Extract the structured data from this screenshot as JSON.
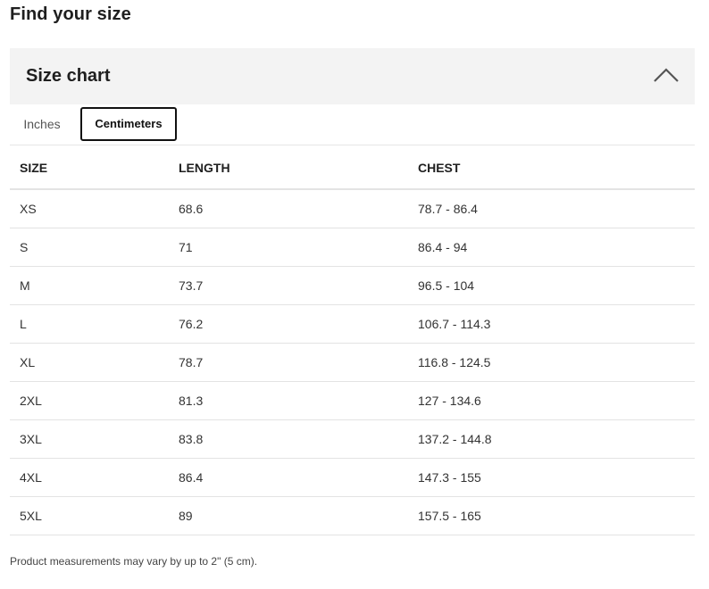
{
  "page": {
    "title": "Find your size",
    "footnote": "Product measurements may vary by up to 2\" (5 cm)."
  },
  "accordion": {
    "title": "Size chart",
    "expanded": true,
    "toggle_icon": "chevron-up-icon"
  },
  "tabs": [
    {
      "label": "Inches",
      "selected": false
    },
    {
      "label": "Centimeters",
      "selected": true
    }
  ],
  "table": {
    "headers": [
      "SIZE",
      "LENGTH",
      "CHEST"
    ],
    "rows": [
      [
        "XS",
        "68.6",
        "78.7 - 86.4"
      ],
      [
        "S",
        "71",
        "86.4 - 94"
      ],
      [
        "M",
        "73.7",
        "96.5 - 104"
      ],
      [
        "L",
        "76.2",
        "106.7 - 114.3"
      ],
      [
        "XL",
        "78.7",
        "116.8 - 124.5"
      ],
      [
        "2XL",
        "81.3",
        "127 - 134.6"
      ],
      [
        "3XL",
        "83.8",
        "137.2 - 144.8"
      ],
      [
        "4XL",
        "86.4",
        "147.3 - 155"
      ],
      [
        "5XL",
        "89",
        "157.5 - 165"
      ]
    ]
  },
  "colors": {
    "header_bg": "#f3f3f3",
    "selected_tab_border": "#111111",
    "divider": "#e3e3e3"
  }
}
